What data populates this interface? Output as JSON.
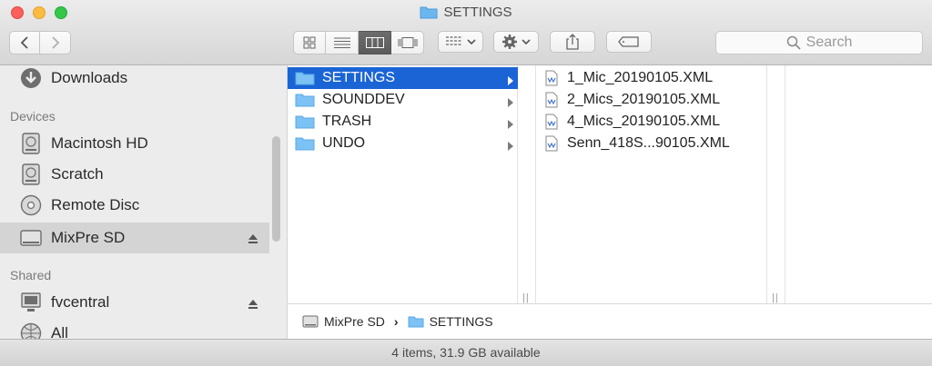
{
  "window": {
    "title": "SETTINGS"
  },
  "toolbar": {
    "search_placeholder": "Search"
  },
  "sidebar": {
    "top_item": "Downloads",
    "devices_header": "Devices",
    "devices": [
      "Macintosh HD",
      "Scratch",
      "Remote Disc",
      "MixPre SD"
    ],
    "shared_header": "Shared",
    "shared": [
      "fvcentral",
      "All"
    ]
  },
  "column1": {
    "items": [
      "SETTINGS",
      "SOUNDDEV",
      "TRASH",
      "UNDO"
    ],
    "selected": "SETTINGS"
  },
  "column2": {
    "files": [
      "1_Mic_20190105.XML",
      "2_Mics_20190105.XML",
      "4_Mics_20190105.XML",
      "Senn_418S...90105.XML"
    ]
  },
  "pathbar": {
    "volume": "MixPre SD",
    "separator": "›",
    "folder": "SETTINGS"
  },
  "status": {
    "text": "4 items, 31.9 GB available"
  },
  "colors": {
    "selection": "#1a64d6",
    "folder": "#6cb6f0"
  },
  "icons": {
    "downloads": "downloads-icon",
    "disk": "hard-disk-icon",
    "disc": "optical-disc-icon",
    "sd": "sd-card-icon",
    "computer": "computer-icon",
    "network": "network-icon",
    "folder": "folder-icon",
    "xml": "xml-file-icon"
  }
}
